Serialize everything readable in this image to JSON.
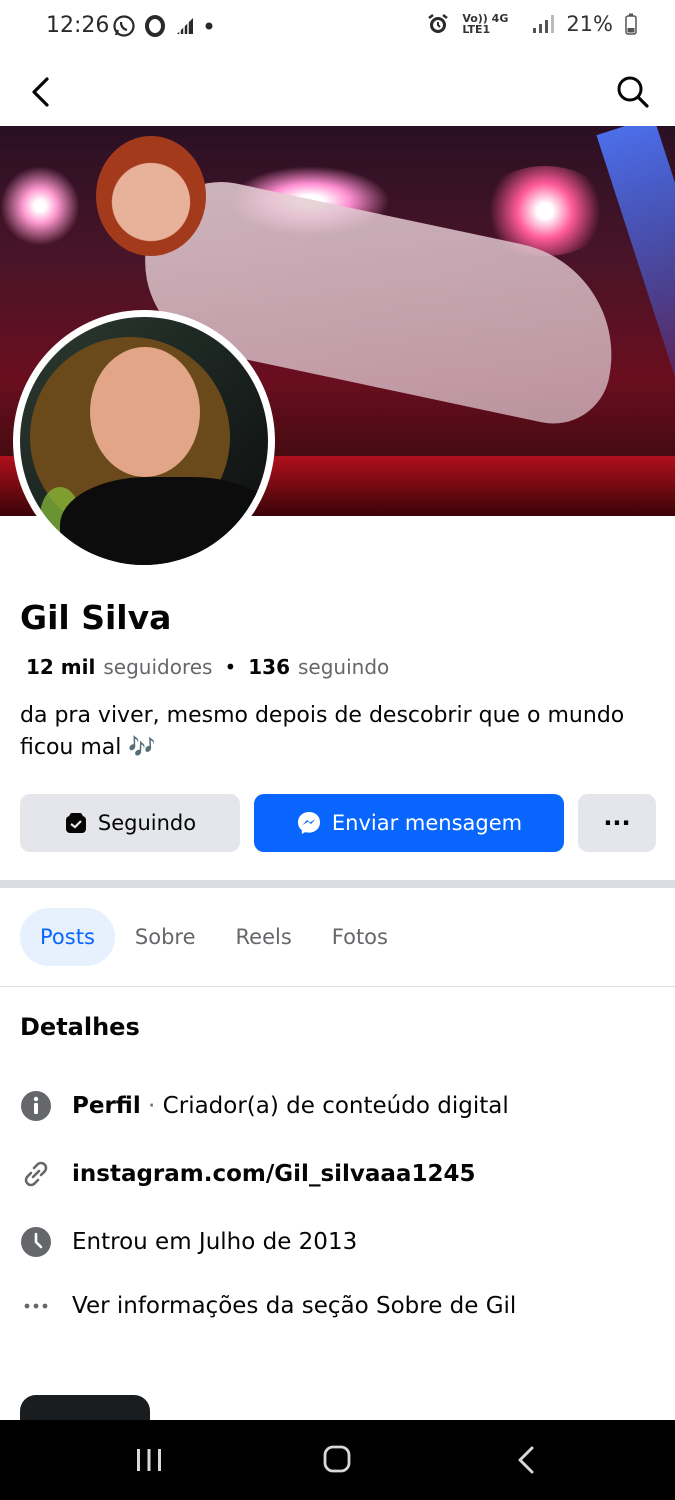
{
  "status_bar": {
    "time": "12:26",
    "left_icons": [
      "whatsapp-icon",
      "circle-o-icon",
      "signal-wave-icon",
      "dot-icon"
    ],
    "network_label": "Vo)) 4G LTE1",
    "battery": "21%"
  },
  "header": {
    "back_icon": "chevron-left-icon",
    "search_icon": "search-icon"
  },
  "profile": {
    "name": "Gil Silva",
    "followers_count": "12 mil",
    "followers_label": "seguidores",
    "separator": "•",
    "following_count": "136",
    "following_label": "seguindo",
    "bio": "da pra viver, mesmo depois de descobrir que o mundo ficou mal",
    "bio_emoji": "🎶"
  },
  "actions": {
    "following_label": "Seguindo",
    "message_label": "Enviar mensagem",
    "more_label": "···"
  },
  "tabs": [
    {
      "label": "Posts",
      "active": true
    },
    {
      "label": "Sobre",
      "active": false
    },
    {
      "label": "Reels",
      "active": false
    },
    {
      "label": "Fotos",
      "active": false
    }
  ],
  "details": {
    "title": "Detalhes",
    "profile_label": "Perfil",
    "profile_value": "Criador(a) de conteúdo digital",
    "link": "instagram.com/Gil_silvaaa1245",
    "joined": "Entrou em Julho de 2013",
    "more": "Ver informações da seção Sobre de Gil"
  },
  "colors": {
    "accent": "#0866ff",
    "button_gray": "#e4e6eb",
    "tab_active_bg": "#e7f0fd",
    "text_secondary": "#65676b"
  }
}
